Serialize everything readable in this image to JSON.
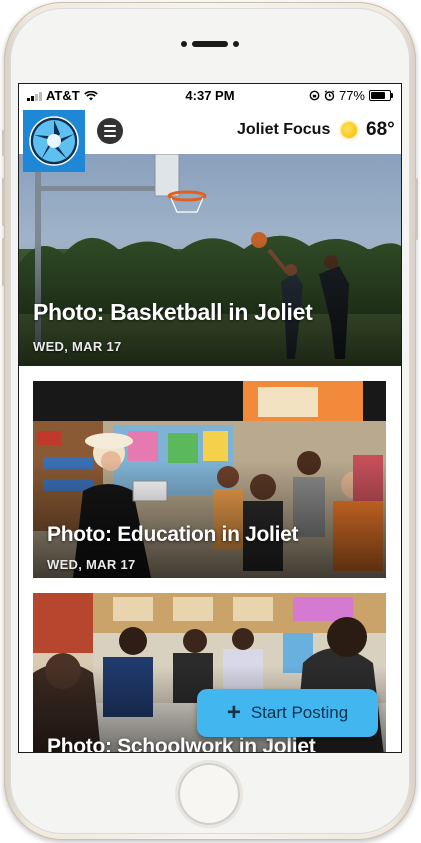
{
  "status_bar": {
    "carrier": "AT&T",
    "time": "4:37 PM",
    "battery_text": "77%",
    "battery_level": 0.77
  },
  "header": {
    "logo_icon": "aperture-logo-icon",
    "menu_icon": "hamburger-menu-icon",
    "title": "Joliet Focus",
    "weather_icon": "sun-icon",
    "temperature": "68°"
  },
  "feed": {
    "items": [
      {
        "title": "Photo: Basketball in Joliet",
        "date": "WED, MAR 17"
      },
      {
        "title": "Photo: Education in Joliet",
        "date": "WED, MAR 17"
      },
      {
        "title": "Photo: Schoolwork in Joliet",
        "date": ""
      }
    ]
  },
  "fab": {
    "label": "Start Posting",
    "icon": "plus-icon"
  },
  "colors": {
    "accent": "#41b6ef",
    "logo_bg": "#1e88d6"
  }
}
